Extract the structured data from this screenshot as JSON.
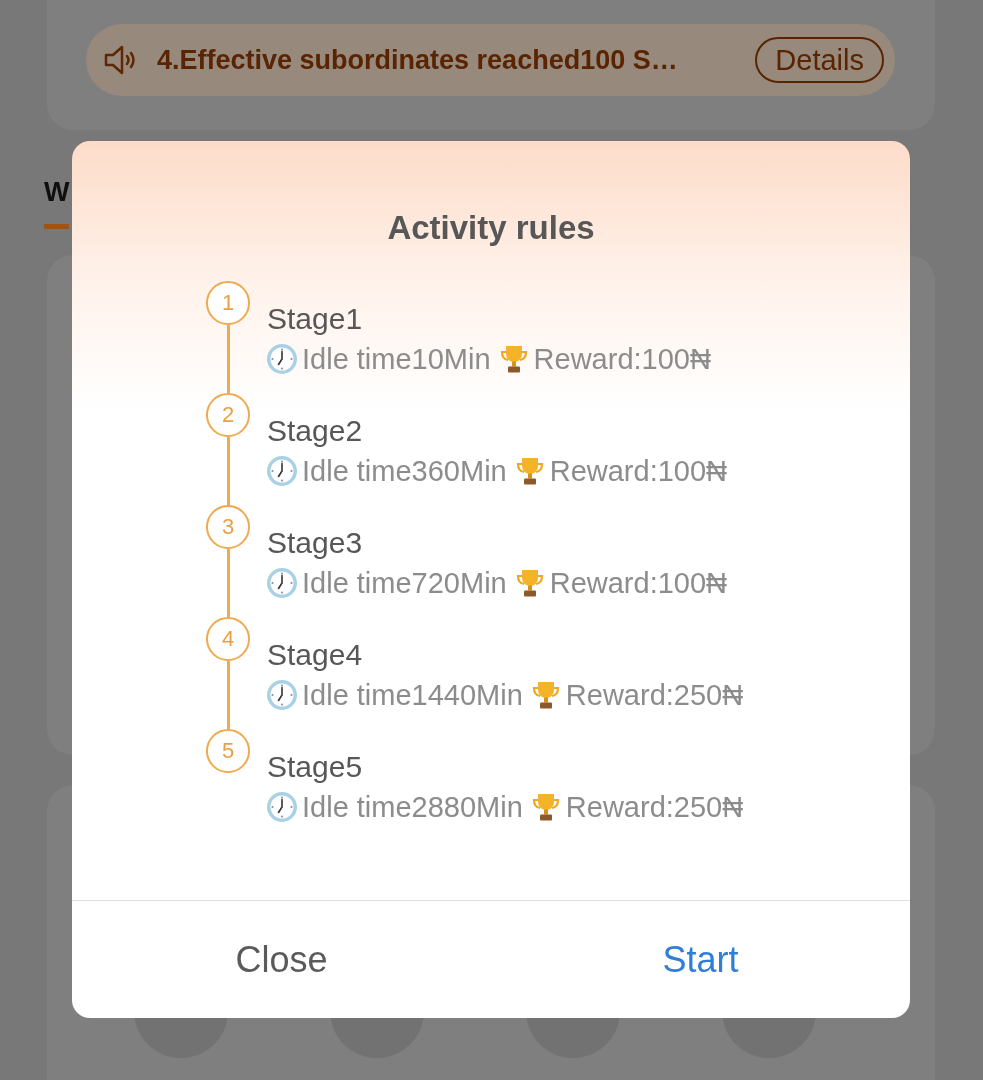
{
  "notice": {
    "text": "4.Effective subordinates reached100 S…",
    "button": "Details"
  },
  "tabs": [
    {
      "label": "W",
      "selected": true
    }
  ],
  "dialog": {
    "title": "Activity rules",
    "stages": [
      {
        "number": "1",
        "title": "Stage1",
        "idle_time": "Idle time10Min",
        "reward": "Reward:100₦"
      },
      {
        "number": "2",
        "title": "Stage2",
        "idle_time": "Idle time360Min",
        "reward": "Reward:100₦"
      },
      {
        "number": "3",
        "title": "Stage3",
        "idle_time": "Idle time720Min",
        "reward": "Reward:100₦"
      },
      {
        "number": "4",
        "title": "Stage4",
        "idle_time": "Idle time1440Min",
        "reward": "Reward:250₦"
      },
      {
        "number": "5",
        "title": "Stage5",
        "idle_time": "Idle time2880Min",
        "reward": "Reward:250₦"
      }
    ],
    "buttons": [
      {
        "label": "Close",
        "kind": "cancel"
      },
      {
        "label": "Start",
        "kind": "confirm"
      }
    ]
  }
}
